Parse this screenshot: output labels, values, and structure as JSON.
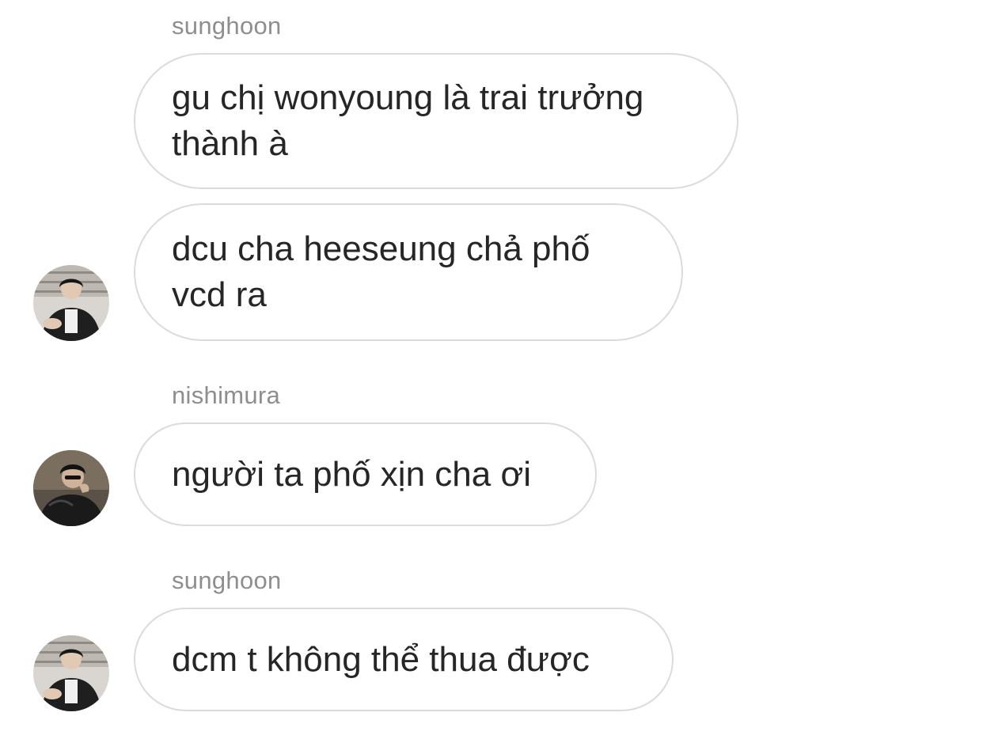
{
  "messages": [
    {
      "sender": "sunghoon",
      "text": "gu chị wonyoung là trai trưởng thành à",
      "avatar_icon": "person-avatar-icon"
    },
    {
      "sender": "",
      "text": "dcu cha heeseung chả phố vcd ra",
      "avatar_icon": "person-avatar-icon"
    },
    {
      "sender": "nishimura",
      "text": "người ta phố xịn cha ơi",
      "avatar_icon": "person-avatar-icon"
    },
    {
      "sender": "sunghoon",
      "text": "dcm t không thể thua được",
      "avatar_icon": "person-avatar-icon"
    }
  ],
  "colors": {
    "bubble_border": "#dbdbdb",
    "sender_text": "#8e8e8e",
    "message_text": "#262626",
    "background": "#ffffff"
  }
}
